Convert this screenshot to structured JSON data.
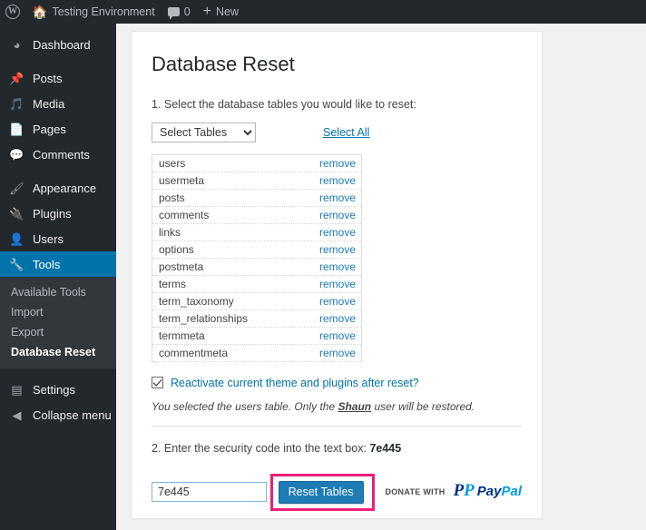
{
  "adminbar": {
    "items": [
      {
        "icon": "wordpress-logo-icon",
        "label": ""
      },
      {
        "icon": "home-icon",
        "label": "Testing Environment"
      },
      {
        "icon": "comment-bubble-icon",
        "label": "0"
      },
      {
        "icon": "plus-icon",
        "label": "New"
      }
    ]
  },
  "sidebar": {
    "items": [
      {
        "label": "Dashboard",
        "icon": "dashboard-icon",
        "glyph": "◔",
        "current": false
      },
      {
        "label": "Posts",
        "icon": "pin-icon",
        "glyph": "✒",
        "current": false
      },
      {
        "label": "Media",
        "icon": "media-icon",
        "glyph": "♫",
        "current": false
      },
      {
        "label": "Pages",
        "icon": "pages-icon",
        "glyph": "▧",
        "current": false
      },
      {
        "label": "Comments",
        "icon": "comments-icon",
        "glyph": "■",
        "current": false
      },
      {
        "label": "Appearance",
        "icon": "paintbrush-icon",
        "glyph": "✒",
        "current": false
      },
      {
        "label": "Plugins",
        "icon": "plug-icon",
        "glyph": "⚒",
        "current": false
      },
      {
        "label": "Users",
        "icon": "user-icon",
        "glyph": "♟",
        "current": false
      },
      {
        "label": "Tools",
        "icon": "wrench-icon",
        "glyph": "⚒",
        "current": true
      }
    ],
    "submenu": [
      {
        "label": "Available Tools",
        "current": false
      },
      {
        "label": "Import",
        "current": false
      },
      {
        "label": "Export",
        "current": false
      },
      {
        "label": "Database Reset",
        "current": true
      }
    ],
    "footer": [
      {
        "label": "Settings",
        "icon": "settings-icon",
        "glyph": "☷"
      },
      {
        "label": "Collapse menu",
        "icon": "collapse-arrow-icon",
        "glyph": "◀"
      }
    ]
  },
  "main": {
    "page_title": "Database Reset",
    "step1_label": "1. Select the database tables you would like to reset:",
    "select": {
      "selected": "Select Tables",
      "options": [
        "Select Tables",
        "users",
        "usermeta",
        "posts",
        "comments",
        "links",
        "options",
        "postmeta",
        "terms",
        "term_taxonomy",
        "term_relationships",
        "termmeta",
        "commentmeta"
      ]
    },
    "select_all_label": "Select All",
    "remove_label": "remove",
    "tables": [
      "users",
      "usermeta",
      "posts",
      "comments",
      "links",
      "options",
      "postmeta",
      "terms",
      "term_taxonomy",
      "term_relationships",
      "termmeta",
      "commentmeta"
    ],
    "reactivate": {
      "checked": true,
      "label": "Reactivate current theme and plugins after reset?"
    },
    "note": {
      "before": "You selected the users table. Only the ",
      "emphasis": "Shaun",
      "after": " user will be restored."
    },
    "step2_label": "2. Enter the security code into the text box:",
    "security_code": "7e445",
    "input_value": "7e445",
    "reset_button_label": "Reset Tables",
    "donate_text": "DONATE WITH",
    "paypal_label": "PayPal"
  },
  "colors": {
    "admin_bar": "#23282d",
    "sidebar": "#23282d",
    "submenu": "#32373c",
    "accent": "#0073aa",
    "link": "#0073aa",
    "button": "#1e7bb5",
    "highlight": "#ed1e79",
    "page_background": "#f1f1f1"
  }
}
